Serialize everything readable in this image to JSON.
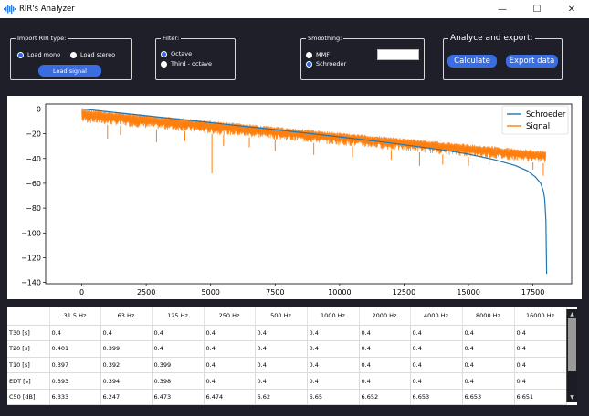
{
  "window": {
    "title": "RIR's Analyzer",
    "controls": [
      "—",
      "☐",
      "✕"
    ]
  },
  "import_group": {
    "title": "Import RIR type:",
    "mono_label": "Load mono",
    "stereo_label": "Load stereo",
    "selected": "mono",
    "load_button": "Load signal"
  },
  "filter_group": {
    "title": "Filter:",
    "octave_label": "Octave",
    "third_label": "Third - octave",
    "selected": "octave"
  },
  "smoothing_group": {
    "title": "Smoothing:",
    "mmf_label": "MMF",
    "schroeder_label": "Schroeder",
    "selected": "schroeder",
    "mmf_value": ""
  },
  "export_group": {
    "title": "Analyce and export:",
    "calculate_button": "Calculate",
    "export_button": "Export data"
  },
  "chart_data": {
    "type": "line",
    "title": "",
    "xlabel": "",
    "ylabel": "",
    "xlim": [
      -1400,
      19000
    ],
    "ylim": [
      -141,
      4
    ],
    "x_ticks": [
      "0",
      "2500",
      "5000",
      "7500",
      "10000",
      "12500",
      "15000",
      "17500"
    ],
    "y_ticks": [
      "0",
      "−20",
      "−40",
      "−60",
      "−80",
      "−100",
      "−120",
      "−140"
    ],
    "legend_position": "top-right",
    "series": [
      {
        "name": "Schroeder",
        "color": "#1f77b4",
        "x": [
          0,
          2000,
          4000,
          6000,
          8000,
          10000,
          12000,
          14000,
          15000,
          16000,
          16800,
          17300,
          17600,
          17800,
          17900,
          17950,
          18000,
          18030
        ],
        "y": [
          0,
          -4.4,
          -8.8,
          -13.3,
          -17.8,
          -22.5,
          -27.5,
          -33,
          -36.5,
          -41,
          -45.5,
          -50,
          -55,
          -60,
          -66,
          -72,
          -90,
          -133
        ]
      },
      {
        "name": "Signal",
        "color": "#ff7f0e",
        "x_range": [
          0,
          18000
        ],
        "upper_envelope": [
          0,
          -34
        ],
        "lower_envelope": [
          -11,
          -44
        ],
        "spikes": [
          {
            "x": 1000,
            "y": -24
          },
          {
            "x": 1500,
            "y": -21
          },
          {
            "x": 2900,
            "y": -27
          },
          {
            "x": 4000,
            "y": -26
          },
          {
            "x": 5050,
            "y": -52
          },
          {
            "x": 5500,
            "y": -30
          },
          {
            "x": 6500,
            "y": -31
          },
          {
            "x": 7500,
            "y": -34
          },
          {
            "x": 9000,
            "y": -37
          },
          {
            "x": 10500,
            "y": -39
          },
          {
            "x": 12000,
            "y": -41
          },
          {
            "x": 13100,
            "y": -46
          },
          {
            "x": 14000,
            "y": -45
          },
          {
            "x": 15000,
            "y": -46
          },
          {
            "x": 15800,
            "y": -45
          },
          {
            "x": 17500,
            "y": -49
          },
          {
            "x": 17900,
            "y": -54
          }
        ]
      }
    ]
  },
  "table": {
    "columns": [
      "31.5 Hz",
      "63 Hz",
      "125 Hz",
      "250 Hz",
      "500 Hz",
      "1000 Hz",
      "2000 Hz",
      "4000 Hz",
      "8000 Hz",
      "16000 Hz"
    ],
    "rows": [
      {
        "label": "T30 [s]",
        "values": [
          "0.4",
          "0.4",
          "0.4",
          "0.4",
          "0.4",
          "0.4",
          "0.4",
          "0.4",
          "0.4",
          "0.4"
        ]
      },
      {
        "label": "T20 [s]",
        "values": [
          "0.401",
          "0.399",
          "0.4",
          "0.4",
          "0.4",
          "0.4",
          "0.4",
          "0.4",
          "0.4",
          "0.4"
        ]
      },
      {
        "label": "T10 [s]",
        "values": [
          "0.397",
          "0.392",
          "0.399",
          "0.4",
          "0.4",
          "0.4",
          "0.4",
          "0.4",
          "0.4",
          "0.4"
        ]
      },
      {
        "label": "EDT [s]",
        "values": [
          "0.393",
          "0.394",
          "0.398",
          "0.4",
          "0.4",
          "0.4",
          "0.4",
          "0.4",
          "0.4",
          "0.4"
        ]
      },
      {
        "label": "C50 [dB]",
        "values": [
          "6.333",
          "6.247",
          "6.473",
          "6.474",
          "6.62",
          "6.65",
          "6.652",
          "6.653",
          "6.653",
          "6.651"
        ]
      }
    ]
  }
}
